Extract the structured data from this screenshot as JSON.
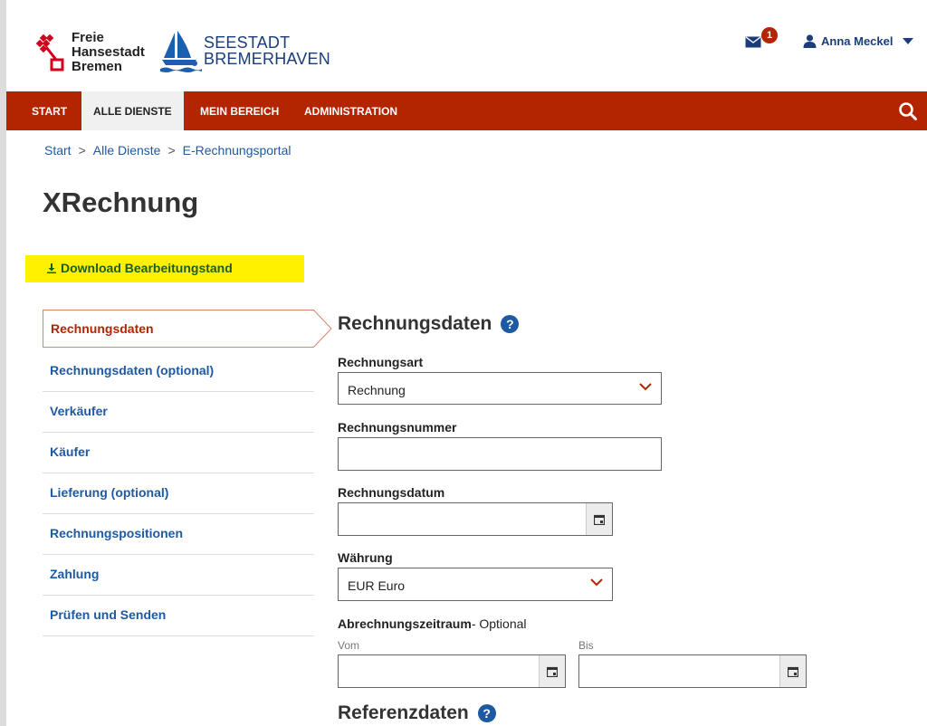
{
  "header": {
    "bremen_logo_lines": [
      "Freie",
      "Hansestadt",
      "Bremen"
    ],
    "seestadt_logo_lines": [
      "SEESTADT",
      "BREMERHAVEN"
    ],
    "mail_badge": "1",
    "user_name": "Anna Meckel"
  },
  "nav": {
    "items": [
      {
        "label": "START"
      },
      {
        "label": "ALLE DIENSTE"
      },
      {
        "label": "MEIN BEREICH"
      },
      {
        "label": "ADMINISTRATION"
      }
    ],
    "active": "ALLE DIENSTE"
  },
  "breadcrumb": [
    "Start",
    "Alle Dienste",
    "E-Rechnungsportal"
  ],
  "page_title": "XRechnung",
  "download_label": "Download Bearbeitungstand",
  "sidenav": {
    "items": [
      {
        "label": "Rechnungsdaten"
      },
      {
        "label": "Rechnungsdaten (optional)"
      },
      {
        "label": "Verkäufer"
      },
      {
        "label": "Käufer"
      },
      {
        "label": "Lieferung (optional)"
      },
      {
        "label": "Rechnungspositionen"
      },
      {
        "label": "Zahlung"
      },
      {
        "label": "Prüfen und Senden"
      }
    ],
    "active": "Rechnungsdaten"
  },
  "form": {
    "section_title": "Rechnungsdaten",
    "rechnungsart": {
      "label": "Rechnungsart",
      "value": "Rechnung"
    },
    "rechnungsnummer": {
      "label": "Rechnungsnummer",
      "value": ""
    },
    "rechnungsdatum": {
      "label": "Rechnungsdatum",
      "value": ""
    },
    "waehrung": {
      "label": "Währung",
      "value": "EUR Euro"
    },
    "abrechnungszeitraum": {
      "label": "Abrechnungszeitraum",
      "optional": "- Optional",
      "from_label": "Vom",
      "to_label": "Bis"
    },
    "next_section_title": "Referenzdaten"
  },
  "colors": {
    "brand_red": "#b32400",
    "link_blue": "#1d5aa3",
    "highlight": "#fff100"
  }
}
